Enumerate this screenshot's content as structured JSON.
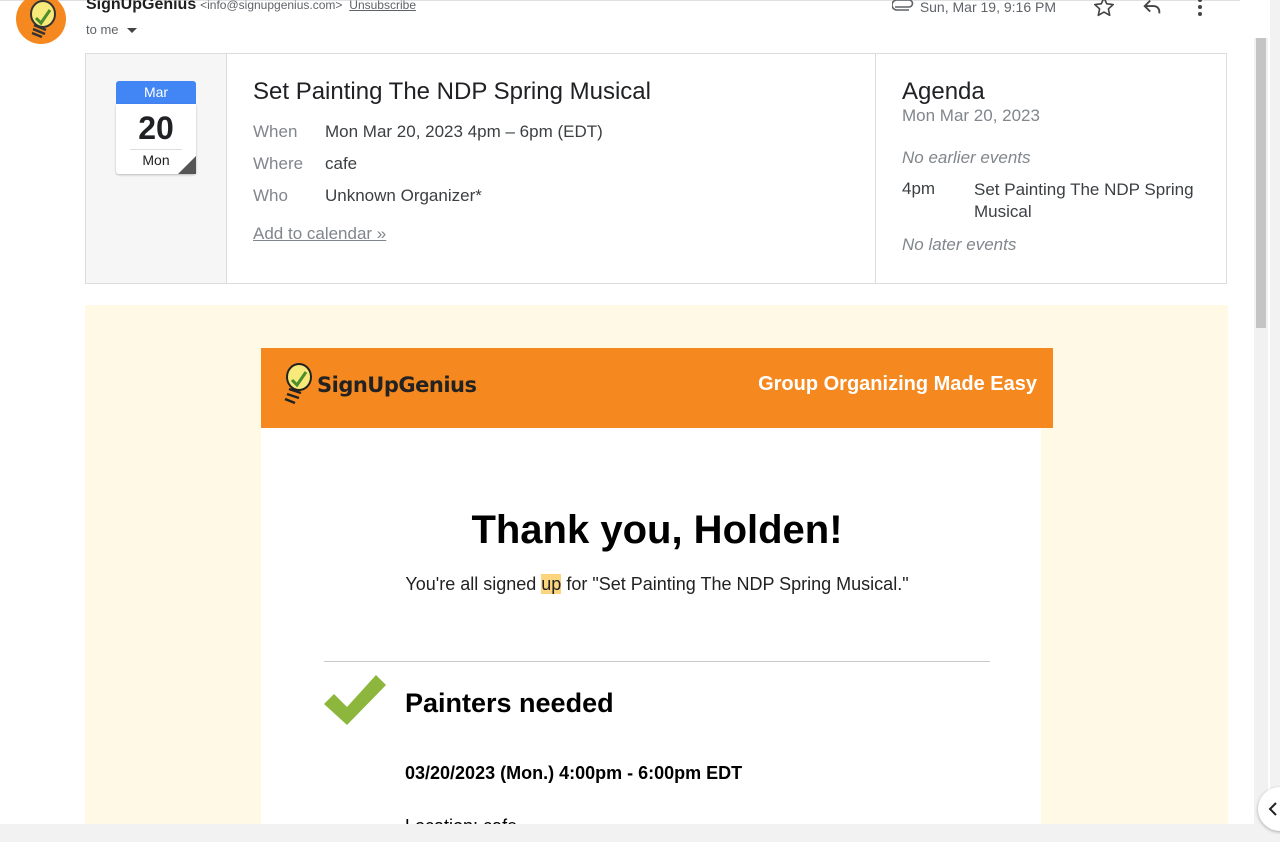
{
  "header": {
    "sender_name": "SignUpGenius",
    "sender_email": "<info@signupgenius.com>",
    "unsubscribe": "Unsubscribe",
    "to_me": "to me",
    "date": "Sun, Mar 19, 9:16 PM"
  },
  "calendar": {
    "month": "Mar",
    "day": "20",
    "weekday": "Mon",
    "title": "Set Painting The NDP Spring Musical",
    "when_label": "When",
    "when_value": "Mon Mar 20, 2023 4pm – 6pm (EDT)",
    "where_label": "Where",
    "where_value": "cafe",
    "who_label": "Who",
    "who_value": "Unknown Organizer*",
    "add_link": "Add to calendar »",
    "agenda_title": "Agenda",
    "agenda_date": "Mon Mar 20, 2023",
    "no_earlier": "No earlier events",
    "agenda_time": "4pm",
    "agenda_event": "Set Painting The NDP Spring Musical",
    "no_later": "No later events"
  },
  "email": {
    "logo_text": "SignUpGenius",
    "tagline": "Group Organizing Made Easy",
    "thanks": "Thank you, Holden!",
    "signed_pre": "You're all signed ",
    "signed_hl": "up",
    "signed_post": " for \"Set Painting The NDP Spring Musical.\"",
    "slot_title": "Painters needed",
    "slot_date": "03/20/2023 (Mon.) 4:00pm - 6:00pm EDT",
    "slot_location": "Location: cafe"
  },
  "colors": {
    "brand_orange": "#f5891f",
    "cream": "#fff9e6",
    "check_green": "#8cb63c",
    "calendar_blue": "#4285f4",
    "highlight": "#fcd57e"
  }
}
